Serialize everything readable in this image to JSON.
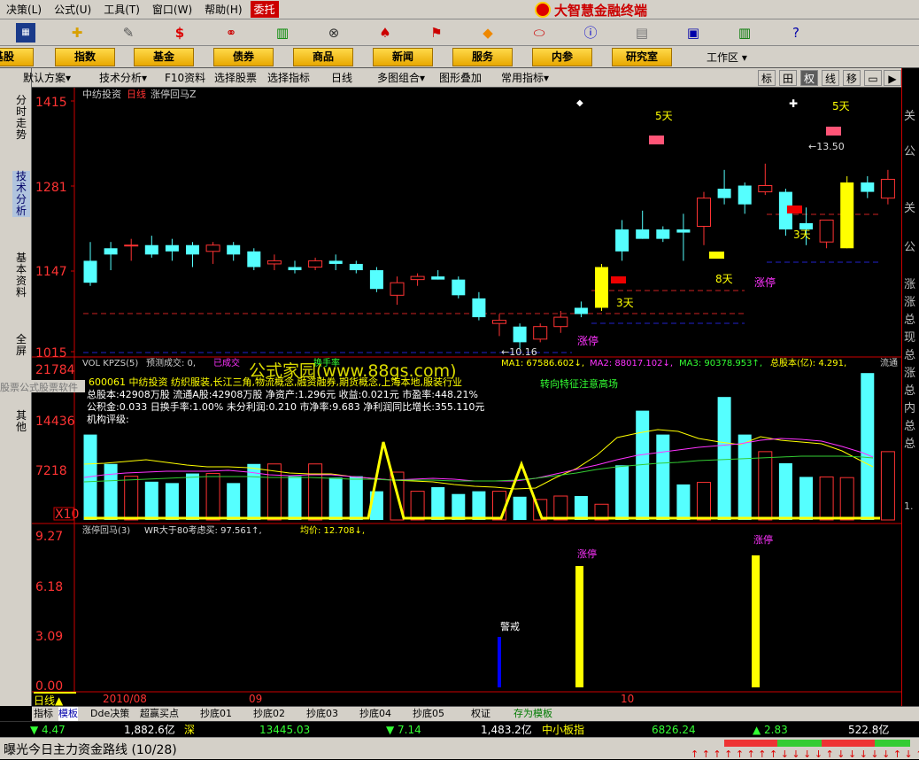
{
  "menu": [
    "决策(L)",
    "公式(U)",
    "工具(T)",
    "窗口(W)",
    "帮助(H)"
  ],
  "menu_highlight": "委托",
  "brand": "大智慧金融终端",
  "nav": [
    "基股",
    "指数",
    "基金",
    "债券",
    "商品",
    "新闻",
    "服务",
    "内参",
    "研究室"
  ],
  "workspace": "工作区",
  "sidebar_tabs": [
    "分时走势",
    "技术分析",
    "基本资料",
    "全屏",
    "其他"
  ],
  "toolbar": {
    "items": [
      "默认方案",
      "技术分析",
      "F10资料",
      "选择股票",
      "选择指标",
      "日线",
      "多图组合",
      "图形叠加",
      "常用指标"
    ],
    "right": [
      "标",
      "田",
      "权",
      "线",
      "移",
      "▭",
      "▶"
    ]
  },
  "main": {
    "header": {
      "stock": "中纺投资",
      "period": "日线",
      "indicator": "涨停回马Z"
    },
    "y_ticks": [
      "1415",
      "1281",
      "1147",
      "1015"
    ],
    "annotations": {
      "d5a": "5天",
      "d5b": "5天",
      "d3a": "3天",
      "d3b": "3天",
      "d8": "8天",
      "zt1": "涨停",
      "zt2": "涨停",
      "hi": "13.50",
      "lo": "10.16"
    }
  },
  "volume": {
    "header": {
      "name": "VOL KPZS(5)",
      "pred": "预测成交: 0,",
      "done": "已成交",
      "turnover": "换手率",
      "ma1": "MA1: 67586.602↓,",
      "ma2": "MA2: 88017.102↓,",
      "ma3": "MA3: 90378.953↑,",
      "capital": "总股本(亿): 4.291,",
      "flow": "流通"
    },
    "info": [
      "600061 中纺投资 纺织服装,长江三角,物流概念,融资融券,期货概念,上海本地,服装行业",
      "总股本:42908万股 流通A股:42908万股 净资产:1.296元 收益:0.021元 市盈率:448.21%",
      "公积金:0.033 日换手率:1.00% 未分利润:0.210 市净率:9.683 净利润同比增长:355.110元",
      "机构评级:"
    ],
    "watermark": "公式家园(www.88gs.com)",
    "y_ticks": [
      "21784",
      "14436",
      "7218",
      "X10"
    ],
    "signal": "转向特征注意高场"
  },
  "indicator": {
    "header": {
      "name": "涨停回马(3)",
      "wr": "WR大于80考虑买: 97.561↑,",
      "avg": "均价: 12.708↓,"
    },
    "y_ticks": [
      "9.27",
      "6.18",
      "3.09",
      "0.00"
    ],
    "labels": {
      "warn": "警戒",
      "zt1": "涨停",
      "zt2": "涨停"
    }
  },
  "xaxis": {
    "period": "日线▲",
    "months": [
      "2010/08",
      "09",
      "10"
    ]
  },
  "left_watermark": "股票公式股票软件",
  "bottom_tabs": [
    "指标",
    "模板",
    "Dde决策",
    "超赢买点",
    "抄底01",
    "抄底02",
    "抄底03",
    "抄底04",
    "抄底05",
    "权证",
    "存为模板"
  ],
  "status": {
    "sh_chg": "▼ 4.47",
    "sh_amt": "1,882.6亿",
    "sz_label": "深",
    "sz_idx": "13445.03",
    "sz_chg": "▼ 7.14",
    "sz_amt": "1,483.2亿",
    "sme_label": "中小板指",
    "sme_idx": "6826.24",
    "sme_chg": "▲ 2.83",
    "sme_amt": "522.8亿"
  },
  "ticker": "曝光今日主力资金路线 (10/28)",
  "right_panel": [
    "关",
    "公",
    "关",
    "公",
    "涨",
    "涨",
    "总",
    "现",
    "总",
    "涨",
    "总",
    "内",
    "总",
    "总",
    "1."
  ],
  "chart_data": [
    {
      "type": "candlestick",
      "title": "中纺投资 日线",
      "ylim": [
        10.15,
        14.15
      ],
      "y_tick_labels": [
        "1415",
        "1281",
        "1147",
        "1015"
      ],
      "ohlc": [
        [
          11.6,
          11.9,
          11.2,
          11.25
        ],
        [
          11.8,
          11.9,
          11.45,
          11.7
        ],
        [
          11.85,
          11.95,
          11.6,
          11.85
        ],
        [
          11.85,
          12.0,
          11.65,
          11.7
        ],
        [
          11.85,
          11.95,
          11.6,
          11.75
        ],
        [
          11.85,
          11.9,
          11.5,
          11.7
        ],
        [
          11.75,
          11.9,
          11.55,
          11.85
        ],
        [
          11.85,
          11.9,
          11.6,
          11.7
        ],
        [
          11.75,
          11.8,
          11.45,
          11.5
        ],
        [
          11.55,
          11.7,
          11.45,
          11.6
        ],
        [
          11.5,
          11.6,
          11.4,
          11.45
        ],
        [
          11.5,
          11.65,
          11.45,
          11.6
        ],
        [
          11.6,
          11.7,
          11.45,
          11.55
        ],
        [
          11.55,
          11.6,
          11.4,
          11.45
        ],
        [
          11.45,
          11.5,
          11.1,
          11.15
        ],
        [
          11.05,
          11.35,
          10.9,
          11.25
        ],
        [
          11.3,
          11.4,
          11.2,
          11.35
        ],
        [
          11.35,
          11.45,
          11.3,
          11.3
        ],
        [
          11.3,
          11.35,
          11.0,
          11.05
        ],
        [
          11.0,
          11.1,
          10.65,
          10.7
        ],
        [
          10.6,
          10.75,
          10.4,
          10.65
        ],
        [
          10.55,
          10.6,
          10.2,
          10.3
        ],
        [
          10.35,
          10.6,
          10.3,
          10.55
        ],
        [
          10.55,
          10.8,
          10.45,
          10.7
        ],
        [
          10.85,
          10.95,
          10.7,
          10.75
        ],
        [
          10.85,
          11.55,
          10.8,
          11.5
        ],
        [
          12.1,
          12.25,
          11.6,
          11.75
        ],
        [
          12.1,
          12.4,
          11.95,
          11.95
        ],
        [
          12.1,
          12.15,
          11.9,
          11.95
        ],
        [
          12.1,
          12.35,
          11.6,
          12.05
        ],
        [
          12.15,
          12.7,
          11.85,
          12.6
        ],
        [
          12.75,
          13.05,
          12.5,
          12.6
        ],
        [
          12.8,
          12.85,
          12.35,
          12.5
        ],
        [
          12.7,
          13.15,
          12.65,
          12.8
        ],
        [
          12.7,
          12.75,
          12.0,
          12.1
        ],
        [
          12.2,
          12.45,
          11.85,
          12.1
        ],
        [
          11.9,
          12.2,
          11.8,
          12.25
        ],
        [
          11.8,
          12.95,
          11.8,
          12.85
        ],
        [
          12.85,
          12.95,
          12.6,
          12.7
        ],
        [
          12.6,
          13.05,
          12.5,
          12.9
        ],
        [
          12.95,
          13.5,
          12.8,
          12.95
        ],
        [
          13.05,
          13.1,
          12.65,
          12.9
        ],
        [
          13.05,
          13.1,
          12.7,
          12.85
        ],
        [
          12.8,
          12.9,
          12.6,
          12.65
        ],
        [
          12.55,
          12.95,
          12.5,
          12.6
        ]
      ]
    },
    {
      "type": "bar",
      "title": "VOL KPZS(5)",
      "ylim": [
        0,
        21784
      ],
      "values": [
        12500,
        8200,
        6400,
        5600,
        5400,
        6800,
        6800,
        5400,
        8200,
        8200,
        6400,
        8200,
        6200,
        6400,
        4200,
        7000,
        4200,
        4800,
        3800,
        4200,
        4200,
        3400,
        3000,
        3500,
        3500,
        2300,
        8000,
        16000,
        12500,
        5200,
        5500,
        18000,
        12500,
        10000,
        8300,
        6300,
        6300,
        6200,
        21500,
        10000,
        8800,
        8500,
        6300,
        5300,
        4000
      ]
    },
    {
      "type": "bar",
      "title": "涨停回马(3)",
      "ylim": [
        0,
        9.27
      ],
      "values": [
        0,
        0,
        0,
        0,
        0,
        0,
        0,
        0,
        0,
        0,
        0,
        0,
        0,
        0,
        0,
        0,
        0,
        0,
        0,
        0,
        0,
        0,
        0,
        2.3,
        0,
        0,
        0,
        0,
        0,
        0,
        0,
        0,
        0,
        0,
        0,
        0,
        0,
        0,
        0,
        0,
        0,
        0,
        0,
        0,
        0
      ],
      "signals": [
        {
          "x": 22,
          "value": 2.3,
          "label": "警戒"
        },
        {
          "x": 25,
          "value": 7.1,
          "label": "涨停"
        },
        {
          "x": 37,
          "value": 8.0,
          "label": "涨停"
        }
      ]
    }
  ]
}
